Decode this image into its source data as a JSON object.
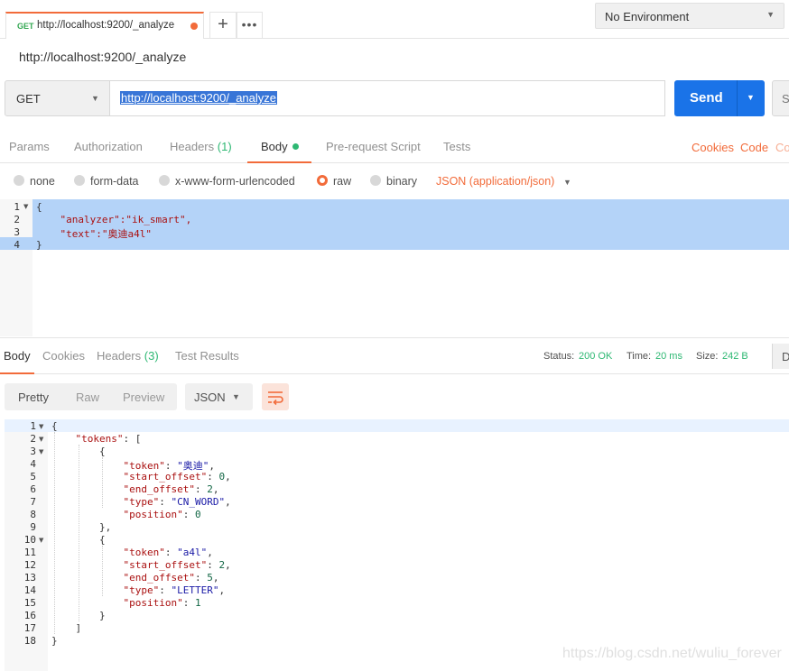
{
  "tab": {
    "method": "GET",
    "url": "http://localhost:9200/_analyze"
  },
  "environment": "No Environment",
  "request_title": "http://localhost:9200/_analyze",
  "request": {
    "method": "GET",
    "url": "http://localhost:9200/_analyze",
    "send_label": "Send",
    "save_label": "S"
  },
  "request_tabs": [
    "Params",
    "Authorization",
    "Headers",
    "(1)",
    "Body",
    "Pre-request Script",
    "Tests"
  ],
  "request_links": {
    "cookies": "Cookies",
    "code": "Code",
    "comments": "Co"
  },
  "body_modes": [
    "none",
    "form-data",
    "x-www-form-urlencoded",
    "raw",
    "binary"
  ],
  "body_content_type": "JSON (application/json)",
  "request_body": {
    "line_numbers": [
      "1",
      "2",
      "3",
      "4"
    ],
    "lines": [
      "{",
      "    \"analyzer\":\"ik_smart\",",
      "    \"text\":\"奥迪a4l\"",
      "}"
    ]
  },
  "response_tabs": [
    "Body",
    "Cookies",
    "Headers",
    "(3)",
    "Test Results"
  ],
  "response_status": {
    "status_label": "Status:",
    "status_value": "200 OK",
    "time_label": "Time:",
    "time_value": "20 ms",
    "size_label": "Size:",
    "size_value": "242 B",
    "download_label": "D"
  },
  "view_modes": [
    "Pretty",
    "Raw",
    "Preview"
  ],
  "response_format": "JSON",
  "response_body": {
    "line_numbers": [
      "1",
      "2",
      "3",
      "4",
      "5",
      "6",
      "7",
      "8",
      "9",
      "10",
      "11",
      "12",
      "13",
      "14",
      "15",
      "16",
      "17",
      "18"
    ],
    "lines": [
      "{",
      "    \"tokens\": [",
      "        {",
      "            \"token\": \"奥迪\",",
      "            \"start_offset\": 0,",
      "            \"end_offset\": 2,",
      "            \"type\": \"CN_WORD\",",
      "            \"position\": 0",
      "        },",
      "        {",
      "            \"token\": \"a4l\",",
      "            \"start_offset\": 2,",
      "            \"end_offset\": 5,",
      "            \"type\": \"LETTER\",",
      "            \"position\": 1",
      "        }",
      "    ]",
      "}"
    ]
  },
  "watermark": "https://blog.csdn.net/wuliu_forever",
  "colors": {
    "accent": "#f26b3a",
    "send": "#1a73e8",
    "success": "#2eb873",
    "selection": "#b4d3f8"
  }
}
